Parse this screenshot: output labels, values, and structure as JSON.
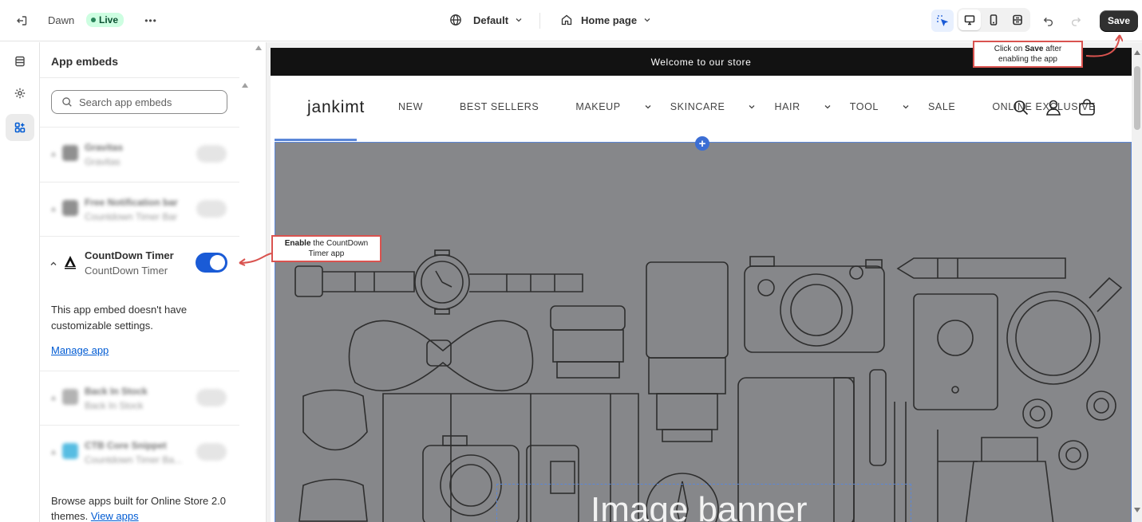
{
  "topbar": {
    "theme_name": "Dawn",
    "live_label": "Live",
    "more_label": "•••",
    "template_select": "Default",
    "page_select": "Home page",
    "save_label": "Save"
  },
  "rail": {
    "items": [
      "sections-icon",
      "settings-icon",
      "app-embeds-icon"
    ]
  },
  "panel": {
    "title": "App embeds",
    "search_placeholder": "Search app embeds",
    "blurred_items": [
      {
        "name": "Gravitas",
        "sub": "Gravitas"
      },
      {
        "name": "Free Notification bar",
        "sub": "Countdown Timer Bar"
      },
      {
        "name": "Back In Stock",
        "sub": "Back In Stock"
      },
      {
        "name": "CTB Core Snippet",
        "sub": "Countdown Timer Ba..."
      }
    ],
    "app": {
      "name": "CountDown Timer",
      "sub": "CountDown Timer",
      "enabled": true,
      "no_settings_text": "This app embed doesn't have customizable settings.",
      "manage_link": "Manage app"
    },
    "footer_text": "Browse apps built for Online Store 2.0 themes.",
    "footer_link": "View apps"
  },
  "preview": {
    "announcement": "Welcome to our store",
    "logo": "jankimt",
    "nav": [
      "NEW",
      "BEST SELLERS",
      "MAKEUP",
      "SKINCARE",
      "HAIR",
      "TOOL",
      "SALE",
      "ONLINE EXCLUSIVE"
    ],
    "nav_dropdowns": [
      false,
      false,
      true,
      true,
      true,
      true,
      false,
      false
    ],
    "banner_title": "Image banner"
  },
  "callouts": {
    "enable_bold": "Enable",
    "enable_rest": " the CountDown Timer app",
    "save_prefix": "Click on ",
    "save_bold": "Save",
    "save_rest": " after enabling the app"
  },
  "colors": {
    "accent": "#1a5bd6",
    "callout_border": "#d9534f",
    "live_bg": "#cdfee1",
    "announce_bg": "#121212",
    "banner_bg": "#86878a"
  }
}
